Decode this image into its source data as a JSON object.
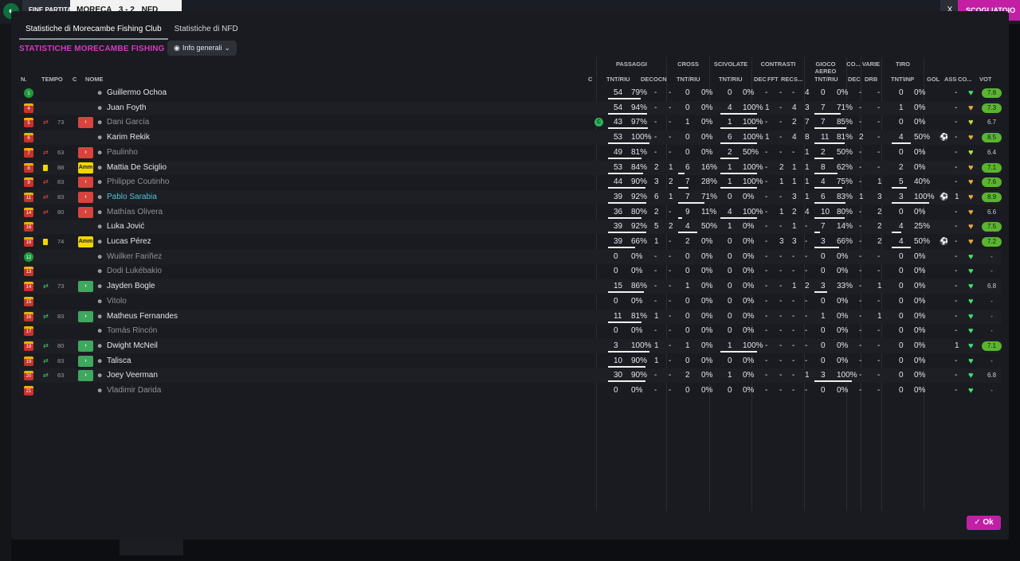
{
  "topbar": {
    "fine_label": "FINE PARTITA",
    "home_team": "MORECA",
    "score": "3 - 2",
    "away_team": "NFD",
    "close_label": "X",
    "right_button": "SCOGLIATOIO"
  },
  "tabs": [
    {
      "label": "Statistiche di Morecambe Fishing Club"
    },
    {
      "label": "Statistiche di NFD"
    }
  ],
  "section_title": "STATISTICHE MORECAMBE FISHING CLUB",
  "dropdown": {
    "label": "Info generali"
  },
  "groups": {
    "passaggi": "PASSAGGI",
    "cross": "CROSS",
    "scivolate": "SCIVOLATE",
    "contrasti": "CONTRASTI",
    "gioco_aereo": "GIOCO AEREO",
    "co": "CO...",
    "varie": "VARIE",
    "tiro": "TIRO"
  },
  "headers": {
    "n": "N.",
    "tempo": "TEMPO",
    "c": "C",
    "nome": "NOME",
    "c2": "C",
    "pass_tnt": "TNT/RIU",
    "dec": "DEC",
    "ocn": "OCN",
    "cross_tnt": "TNT/RIU",
    "sciv_tnt": "TNT/RIU",
    "cont_dec": "DEC",
    "fft": "FFT",
    "rec": "REC",
    "s": "S...",
    "aereo_tnt": "TNT/RIU",
    "co_dec": "DEC",
    "drb": "DRB",
    "tiro_tnt": "TNT\\INP",
    "gol": "GOL",
    "ass": "ASS",
    "co2": "CO...",
    "vot": "VOT"
  },
  "players": [
    {
      "n": "1",
      "gk": true,
      "min": "",
      "sub": "",
      "card": "",
      "badge": "",
      "name": "Guillermo Ochoa",
      "style": "",
      "c": "",
      "pt": "54",
      "pp": "79%",
      "pb": 0.79,
      "dec": "-",
      "ocn": "-",
      "ct": "0",
      "cp": "0%",
      "cb": 0,
      "st": "0",
      "sp": "0%",
      "sb": 0,
      "cdec": "-",
      "fft": "-",
      "rec": "-",
      "s": "4",
      "at": "0",
      "ap": "0%",
      "ab": 0,
      "codec": "-",
      "drb": "-",
      "tt": "0",
      "tp": "0%",
      "tb": 0,
      "gol": "",
      "ass": "-",
      "heart": "green",
      "vot": "7.8",
      "votpill": true
    },
    {
      "n": "4",
      "gk": false,
      "min": "",
      "sub": "",
      "card": "",
      "badge": "",
      "name": "Juan Foyth",
      "style": "",
      "c": "",
      "pt": "54",
      "pp": "94%",
      "pb": 0.94,
      "dec": "-",
      "ocn": "-",
      "ct": "0",
      "cp": "0%",
      "cb": 0,
      "st": "4",
      "sp": "100%",
      "sb": 1,
      "cdec": "1",
      "fft": "-",
      "rec": "4",
      "s": "3",
      "at": "7",
      "ap": "71%",
      "ab": 0.71,
      "codec": "-",
      "drb": "-",
      "tt": "1",
      "tp": "0%",
      "tb": 0,
      "gol": "",
      "ass": "-",
      "heart": "gold",
      "vot": "7.3",
      "votpill": true
    },
    {
      "n": "5",
      "gk": false,
      "min": "73",
      "sub": "out",
      "card": "",
      "badge": "out",
      "name": "Dani García",
      "style": "sub",
      "c": "motm",
      "pt": "43",
      "pp": "97%",
      "pb": 0.97,
      "dec": "-",
      "ocn": "-",
      "ct": "1",
      "cp": "0%",
      "cb": 0,
      "st": "1",
      "sp": "100%",
      "sb": 1,
      "cdec": "-",
      "fft": "-",
      "rec": "2",
      "s": "7",
      "at": "7",
      "ap": "85%",
      "ab": 0.85,
      "codec": "-",
      "drb": "-",
      "tt": "0",
      "tp": "0%",
      "tb": 0,
      "gol": "",
      "ass": "-",
      "heart": "lime",
      "vot": "6.7",
      "votpill": false
    },
    {
      "n": "6",
      "gk": false,
      "min": "",
      "sub": "",
      "card": "",
      "badge": "",
      "name": "Karim Rekik",
      "style": "",
      "c": "",
      "pt": "53",
      "pp": "100%",
      "pb": 1,
      "dec": "-",
      "ocn": "-",
      "ct": "0",
      "cp": "0%",
      "cb": 0,
      "st": "6",
      "sp": "100%",
      "sb": 1,
      "cdec": "1",
      "fft": "-",
      "rec": "4",
      "s": "8",
      "at": "11",
      "ap": "81%",
      "ab": 0.81,
      "codec": "2",
      "drb": "-",
      "tt": "4",
      "tp": "50%",
      "tb": 0.5,
      "gol": "ball",
      "ass": "-",
      "heart": "gold",
      "vot": "8.5",
      "votpill": true
    },
    {
      "n": "7",
      "gk": false,
      "min": "63",
      "sub": "out",
      "card": "",
      "badge": "out",
      "name": "Paulinho",
      "style": "sub",
      "c": "",
      "pt": "49",
      "pp": "81%",
      "pb": 0.81,
      "dec": "-",
      "ocn": "-",
      "ct": "0",
      "cp": "0%",
      "cb": 0,
      "st": "2",
      "sp": "50%",
      "sb": 0.5,
      "cdec": "-",
      "fft": "-",
      "rec": "-",
      "s": "1",
      "at": "2",
      "ap": "50%",
      "ab": 0.5,
      "codec": "-",
      "drb": "-",
      "tt": "0",
      "tp": "0%",
      "tb": 0,
      "gol": "",
      "ass": "-",
      "heart": "lime",
      "vot": "6.4",
      "votpill": false
    },
    {
      "n": "8",
      "gk": false,
      "min": "88",
      "sub": "",
      "card": "yellow",
      "badge": "amm",
      "name": "Mattia De Sciglio",
      "style": "",
      "c": "",
      "pt": "53",
      "pp": "84%",
      "pb": 0.84,
      "dec": "2",
      "ocn": "1",
      "ct": "6",
      "cp": "16%",
      "cb": 0.16,
      "st": "1",
      "sp": "100%",
      "sb": 1,
      "cdec": "-",
      "fft": "2",
      "rec": "1",
      "s": "1",
      "at": "8",
      "ap": "62%",
      "ab": 0.62,
      "codec": "-",
      "drb": "-",
      "tt": "2",
      "tp": "0%",
      "tb": 0,
      "gol": "",
      "ass": "-",
      "heart": "gold",
      "vot": "7.1",
      "votpill": true
    },
    {
      "n": "9",
      "gk": false,
      "min": "83",
      "sub": "out",
      "card": "",
      "badge": "out",
      "name": "Philippe Coutinho",
      "style": "sub",
      "c": "",
      "pt": "44",
      "pp": "90%",
      "pb": 0.9,
      "dec": "3",
      "ocn": "2",
      "ct": "7",
      "cp": "28%",
      "cb": 0.28,
      "st": "1",
      "sp": "100%",
      "sb": 1,
      "cdec": "-",
      "fft": "1",
      "rec": "1",
      "s": "1",
      "at": "4",
      "ap": "75%",
      "ab": 0.75,
      "codec": "-",
      "drb": "1",
      "tt": "5",
      "tp": "40%",
      "tb": 0.4,
      "gol": "",
      "ass": "-",
      "heart": "gold",
      "vot": "7.6",
      "votpill": true
    },
    {
      "n": "11",
      "gk": false,
      "min": "83",
      "sub": "out",
      "card": "",
      "badge": "out",
      "name": "Pablo Sarabia",
      "style": "hl",
      "c": "",
      "pt": "39",
      "pp": "92%",
      "pb": 0.92,
      "dec": "6",
      "ocn": "1",
      "ct": "7",
      "cp": "71%",
      "cb": 0.71,
      "st": "0",
      "sp": "0%",
      "sb": 0,
      "cdec": "-",
      "fft": "-",
      "rec": "3",
      "s": "1",
      "at": "6",
      "ap": "83%",
      "ab": 0.83,
      "codec": "1",
      "drb": "3",
      "tt": "3",
      "tp": "100%",
      "tb": 1,
      "gol": "ball",
      "ass": "1",
      "heart": "gold",
      "vot": "8.9",
      "votpill": true
    },
    {
      "n": "14",
      "gk": false,
      "min": "80",
      "sub": "out",
      "card": "",
      "badge": "out",
      "name": "Mathías Olivera",
      "style": "sub",
      "c": "",
      "pt": "36",
      "pp": "80%",
      "pb": 0.8,
      "dec": "2",
      "ocn": "-",
      "ct": "9",
      "cp": "11%",
      "cb": 0.11,
      "st": "4",
      "sp": "100%",
      "sb": 1,
      "cdec": "-",
      "fft": "1",
      "rec": "2",
      "s": "4",
      "at": "10",
      "ap": "80%",
      "ab": 0.8,
      "codec": "-",
      "drb": "2",
      "tt": "0",
      "tp": "0%",
      "tb": 0,
      "gol": "",
      "ass": "-",
      "heart": "gold",
      "vot": "6.6",
      "votpill": false
    },
    {
      "n": "16",
      "gk": false,
      "min": "",
      "sub": "",
      "card": "",
      "badge": "",
      "name": "Luka Jović",
      "style": "",
      "c": "",
      "pt": "39",
      "pp": "92%",
      "pb": 0.92,
      "dec": "5",
      "ocn": "2",
      "ct": "4",
      "cp": "50%",
      "cb": 0.5,
      "st": "1",
      "sp": "0%",
      "sb": 0,
      "cdec": "-",
      "fft": "-",
      "rec": "1",
      "s": "-",
      "at": "7",
      "ap": "14%",
      "ab": 0.14,
      "codec": "-",
      "drb": "2",
      "tt": "4",
      "tp": "25%",
      "tb": 0.25,
      "gol": "",
      "ass": "-",
      "heart": "gold",
      "vot": "7.5",
      "votpill": true
    },
    {
      "n": "18",
      "gk": false,
      "min": "74",
      "sub": "",
      "card": "yellow",
      "badge": "amm",
      "name": "Lucas Pérez",
      "style": "",
      "c": "",
      "pt": "39",
      "pp": "66%",
      "pb": 0.66,
      "dec": "1",
      "ocn": "-",
      "ct": "2",
      "cp": "0%",
      "cb": 0,
      "st": "0",
      "sp": "0%",
      "sb": 0,
      "cdec": "-",
      "fft": "3",
      "rec": "3",
      "s": "-",
      "at": "3",
      "ap": "66%",
      "ab": 0.66,
      "codec": "-",
      "drb": "2",
      "tt": "4",
      "tp": "50%",
      "tb": 0.5,
      "gol": "ball",
      "ass": "-",
      "heart": "gold",
      "vot": "7.2",
      "votpill": true
    },
    {
      "n": "12",
      "gk": true,
      "min": "",
      "sub": "",
      "card": "",
      "badge": "",
      "name": "Wuilker Fariñez",
      "style": "sub",
      "c": "",
      "pt": "0",
      "pp": "0%",
      "pb": 0,
      "dec": "-",
      "ocn": "-",
      "ct": "0",
      "cp": "0%",
      "cb": 0,
      "st": "0",
      "sp": "0%",
      "sb": 0,
      "cdec": "-",
      "fft": "-",
      "rec": "-",
      "s": "-",
      "at": "0",
      "ap": "0%",
      "ab": 0,
      "codec": "-",
      "drb": "-",
      "tt": "0",
      "tp": "0%",
      "tb": 0,
      "gol": "",
      "ass": "-",
      "heart": "green",
      "vot": "-",
      "votpill": false
    },
    {
      "n": "13",
      "gk": false,
      "min": "",
      "sub": "",
      "card": "",
      "badge": "",
      "name": "Dodi Lukébakio",
      "style": "sub",
      "c": "",
      "pt": "0",
      "pp": "0%",
      "pb": 0,
      "dec": "-",
      "ocn": "-",
      "ct": "0",
      "cp": "0%",
      "cb": 0,
      "st": "0",
      "sp": "0%",
      "sb": 0,
      "cdec": "-",
      "fft": "-",
      "rec": "-",
      "s": "-",
      "at": "0",
      "ap": "0%",
      "ab": 0,
      "codec": "-",
      "drb": "-",
      "tt": "0",
      "tp": "0%",
      "tb": 0,
      "gol": "",
      "ass": "-",
      "heart": "green",
      "vot": "-",
      "votpill": false
    },
    {
      "n": "14",
      "gk": false,
      "min": "73",
      "sub": "in",
      "card": "",
      "badge": "in",
      "name": "Jayden Bogle",
      "style": "",
      "c": "",
      "pt": "15",
      "pp": "86%",
      "pb": 0.86,
      "dec": "-",
      "ocn": "-",
      "ct": "1",
      "cp": "0%",
      "cb": 0,
      "st": "0",
      "sp": "0%",
      "sb": 0,
      "cdec": "-",
      "fft": "-",
      "rec": "1",
      "s": "2",
      "at": "3",
      "ap": "33%",
      "ab": 0.33,
      "codec": "-",
      "drb": "1",
      "tt": "0",
      "tp": "0%",
      "tb": 0,
      "gol": "",
      "ass": "-",
      "heart": "green",
      "vot": "6.8",
      "votpill": false
    },
    {
      "n": "15",
      "gk": false,
      "min": "",
      "sub": "",
      "card": "",
      "badge": "",
      "name": "Vitolo",
      "style": "sub",
      "c": "",
      "pt": "0",
      "pp": "0%",
      "pb": 0,
      "dec": "-",
      "ocn": "-",
      "ct": "0",
      "cp": "0%",
      "cb": 0,
      "st": "0",
      "sp": "0%",
      "sb": 0,
      "cdec": "-",
      "fft": "-",
      "rec": "-",
      "s": "-",
      "at": "0",
      "ap": "0%",
      "ab": 0,
      "codec": "-",
      "drb": "-",
      "tt": "0",
      "tp": "0%",
      "tb": 0,
      "gol": "",
      "ass": "-",
      "heart": "green",
      "vot": "-",
      "votpill": false
    },
    {
      "n": "16",
      "gk": false,
      "min": "83",
      "sub": "in",
      "card": "",
      "badge": "in",
      "name": "Matheus Fernandes",
      "style": "",
      "c": "",
      "pt": "11",
      "pp": "81%",
      "pb": 0.81,
      "dec": "1",
      "ocn": "-",
      "ct": "0",
      "cp": "0%",
      "cb": 0,
      "st": "0",
      "sp": "0%",
      "sb": 0,
      "cdec": "-",
      "fft": "-",
      "rec": "-",
      "s": "-",
      "at": "1",
      "ap": "0%",
      "ab": 0,
      "codec": "-",
      "drb": "1",
      "tt": "0",
      "tp": "0%",
      "tb": 0,
      "gol": "",
      "ass": "-",
      "heart": "green",
      "vot": "-",
      "votpill": false
    },
    {
      "n": "17",
      "gk": false,
      "min": "",
      "sub": "",
      "card": "",
      "badge": "",
      "name": "Tomás Rincón",
      "style": "sub",
      "c": "",
      "pt": "0",
      "pp": "0%",
      "pb": 0,
      "dec": "-",
      "ocn": "-",
      "ct": "0",
      "cp": "0%",
      "cb": 0,
      "st": "0",
      "sp": "0%",
      "sb": 0,
      "cdec": "-",
      "fft": "-",
      "rec": "-",
      "s": "-",
      "at": "0",
      "ap": "0%",
      "ab": 0,
      "codec": "-",
      "drb": "-",
      "tt": "0",
      "tp": "0%",
      "tb": 0,
      "gol": "",
      "ass": "-",
      "heart": "green",
      "vot": "-",
      "votpill": false
    },
    {
      "n": "18",
      "gk": false,
      "min": "80",
      "sub": "in",
      "card": "",
      "badge": "in",
      "name": "Dwight McNeil",
      "style": "",
      "c": "",
      "pt": "3",
      "pp": "100%",
      "pb": 1,
      "dec": "1",
      "ocn": "-",
      "ct": "1",
      "cp": "0%",
      "cb": 0,
      "st": "1",
      "sp": "100%",
      "sb": 1,
      "cdec": "-",
      "fft": "-",
      "rec": "-",
      "s": "-",
      "at": "0",
      "ap": "0%",
      "ab": 0,
      "codec": "-",
      "drb": "-",
      "tt": "0",
      "tp": "0%",
      "tb": 0,
      "gol": "",
      "ass": "1",
      "heart": "green",
      "vot": "7.1",
      "votpill": true
    },
    {
      "n": "19",
      "gk": false,
      "min": "83",
      "sub": "in",
      "card": "",
      "badge": "in",
      "name": "Talisca",
      "style": "",
      "c": "",
      "pt": "10",
      "pp": "90%",
      "pb": 0.9,
      "dec": "1",
      "ocn": "-",
      "ct": "0",
      "cp": "0%",
      "cb": 0,
      "st": "0",
      "sp": "0%",
      "sb": 0,
      "cdec": "-",
      "fft": "-",
      "rec": "-",
      "s": "-",
      "at": "0",
      "ap": "0%",
      "ab": 0,
      "codec": "-",
      "drb": "-",
      "tt": "0",
      "tp": "0%",
      "tb": 0,
      "gol": "",
      "ass": "-",
      "heart": "green",
      "vot": "-",
      "votpill": false
    },
    {
      "n": "20",
      "gk": false,
      "min": "63",
      "sub": "in",
      "card": "",
      "badge": "in",
      "name": "Joey Veerman",
      "style": "",
      "c": "",
      "pt": "30",
      "pp": "90%",
      "pb": 0.9,
      "dec": "-",
      "ocn": "-",
      "ct": "2",
      "cp": "0%",
      "cb": 0,
      "st": "1",
      "sp": "0%",
      "sb": 0,
      "cdec": "-",
      "fft": "-",
      "rec": "-",
      "s": "1",
      "at": "3",
      "ap": "100%",
      "ab": 1,
      "codec": "-",
      "drb": "-",
      "tt": "0",
      "tp": "0%",
      "tb": 0,
      "gol": "",
      "ass": "-",
      "heart": "green",
      "vot": "6.8",
      "votpill": false
    },
    {
      "n": "21",
      "gk": false,
      "min": "",
      "sub": "",
      "card": "",
      "badge": "",
      "name": "Vladimir Darida",
      "style": "sub",
      "c": "",
      "pt": "0",
      "pp": "0%",
      "pb": 0,
      "dec": "-",
      "ocn": "-",
      "ct": "0",
      "cp": "0%",
      "cb": 0,
      "st": "0",
      "sp": "0%",
      "sb": 0,
      "cdec": "-",
      "fft": "-",
      "rec": "-",
      "s": "-",
      "at": "0",
      "ap": "0%",
      "ab": 0,
      "codec": "-",
      "drb": "-",
      "tt": "0",
      "tp": "0%",
      "tb": 0,
      "gol": "",
      "ass": "-",
      "heart": "green",
      "vot": "-",
      "votpill": false
    }
  ],
  "badge_text": {
    "amm": "Amm"
  },
  "ok_button": {
    "label": "Ok"
  }
}
